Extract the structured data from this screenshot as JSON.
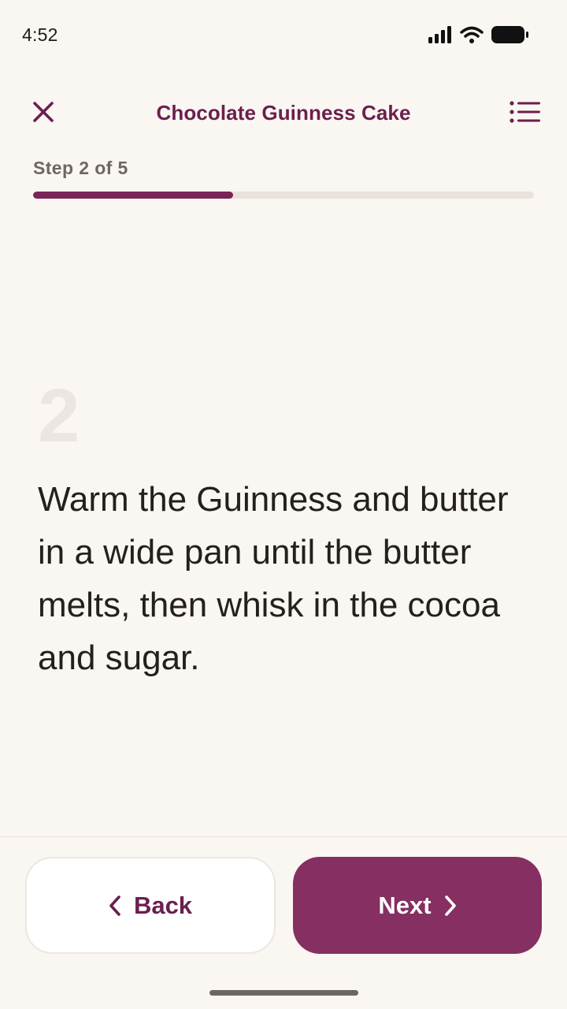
{
  "status_bar": {
    "time": "4:52",
    "icons": [
      "signal-icon",
      "wifi-icon",
      "battery-icon"
    ]
  },
  "header": {
    "title": "Chocolate Guinness Cake",
    "close_icon": "close-icon",
    "menu_icon": "list-icon"
  },
  "progress": {
    "label": "Step 2 of 5",
    "current": 2,
    "total": 5,
    "fraction": 0.4
  },
  "step": {
    "number": "2",
    "instruction": "Warm the Guinness and butter in a wide pan until the butter melts, then whisk in the cocoa and sugar."
  },
  "navigation": {
    "back_label": "Back",
    "next_label": "Next"
  },
  "colors": {
    "accent": "#7a2457",
    "button_primary": "#852f62",
    "title": "#6b1f4d",
    "background": "#faf6f1"
  }
}
